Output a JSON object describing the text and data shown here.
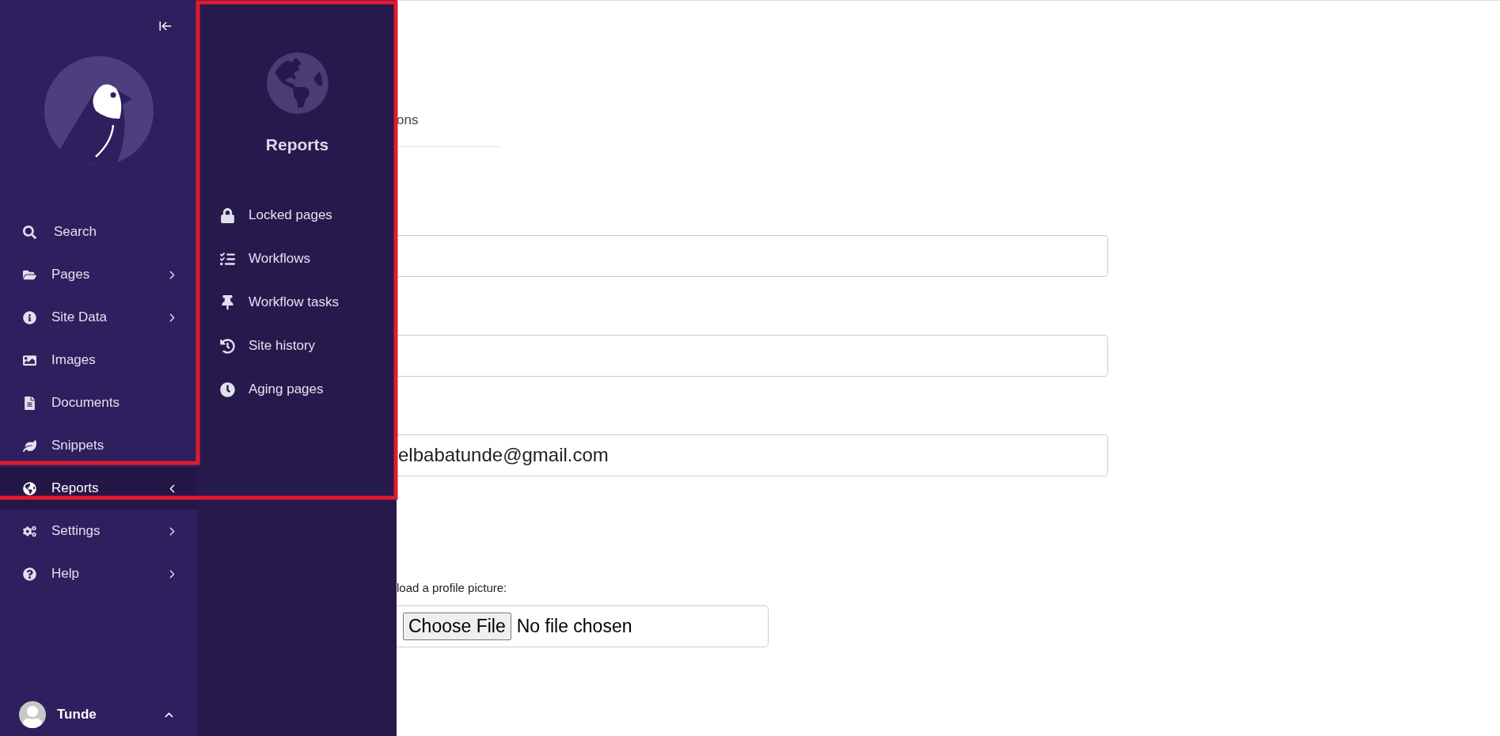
{
  "sidebar": {
    "items": [
      {
        "label": "Search",
        "kind": "link",
        "selected": false
      },
      {
        "label": "Pages",
        "kind": "menu",
        "selected": false,
        "expanded": false
      },
      {
        "label": "Site Data",
        "kind": "menu",
        "selected": false,
        "expanded": false
      },
      {
        "label": "Images",
        "kind": "link",
        "selected": false
      },
      {
        "label": "Documents",
        "kind": "link",
        "selected": false
      },
      {
        "label": "Snippets",
        "kind": "link",
        "selected": false
      },
      {
        "label": "Reports",
        "kind": "menu",
        "selected": true,
        "expanded": true
      },
      {
        "label": "Settings",
        "kind": "menu",
        "selected": false,
        "expanded": false
      },
      {
        "label": "Help",
        "kind": "menu",
        "selected": false,
        "expanded": false
      }
    ],
    "user": {
      "name": "Tunde"
    }
  },
  "submenu": {
    "title": "Reports",
    "items": [
      {
        "label": "Locked pages"
      },
      {
        "label": "Workflows"
      },
      {
        "label": "Workflow tasks"
      },
      {
        "label": "Site history"
      },
      {
        "label": "Aging pages"
      }
    ]
  },
  "content": {
    "tab_fragment": "ons",
    "fields": [
      {
        "kind": "empty"
      },
      {
        "kind": "empty"
      },
      {
        "kind": "filled",
        "value": "elbabatunde@gmail.com"
      }
    ],
    "upload": {
      "label": "load a profile picture:",
      "button": "Choose File",
      "status": "No file chosen"
    }
  },
  "highlight": {
    "color": "#e31b2f"
  }
}
